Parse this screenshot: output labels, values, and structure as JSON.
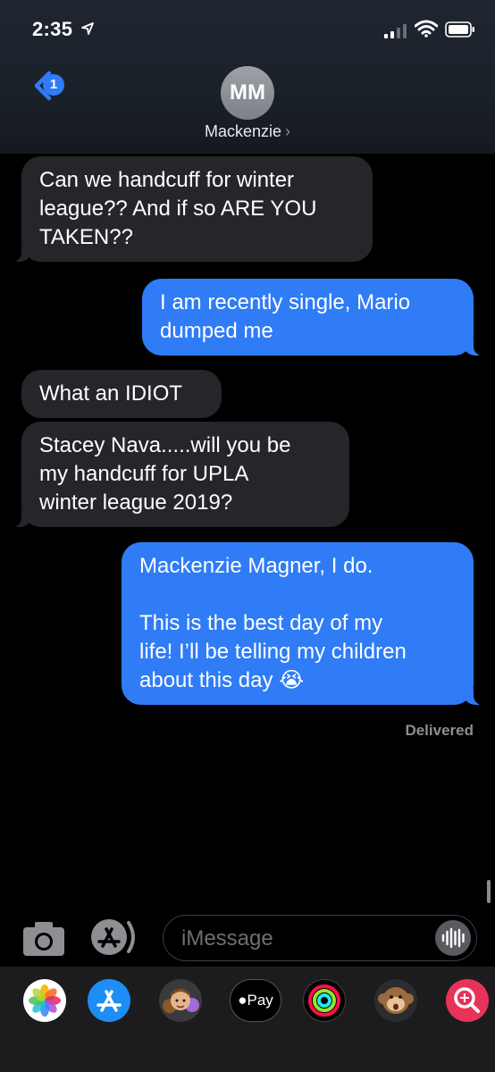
{
  "status_bar": {
    "time": "2:35"
  },
  "header": {
    "back_count": "1",
    "avatar_initials": "MM",
    "contact_name": "Mackenzie",
    "chevron": "›"
  },
  "messages": [
    {
      "direction": "incoming",
      "text": "Can we handcuff for winter\nleague?? And if so ARE YOU\nTAKEN??"
    },
    {
      "direction": "outgoing",
      "text": "I am recently single, Mario\ndumped me"
    },
    {
      "direction": "incoming",
      "text": "What an IDIOT"
    },
    {
      "direction": "incoming",
      "text": "Stacey Nava.....will you be\nmy handcuff for UPLA\nwinter league 2019?"
    },
    {
      "direction": "outgoing",
      "text": "Mackenzie Magner, I do.\n\nThis is the best day of my\nlife! I’ll be telling my children\nabout this day 😭"
    }
  ],
  "delivery_status": "Delivered",
  "composer": {
    "placeholder": "iMessage",
    "camera_icon": "camera-icon",
    "apps_icon": "app-store-icon",
    "audio_icon": "audio-waveform-icon"
  },
  "app_drawer": {
    "items": [
      {
        "name": "photos-icon"
      },
      {
        "name": "app-store-icon"
      },
      {
        "name": "memoji-icon"
      },
      {
        "name": "apple-pay-icon",
        "label": "Pay"
      },
      {
        "name": "activity-icon"
      },
      {
        "name": "animoji-monkey-icon"
      },
      {
        "name": "image-search-icon"
      }
    ]
  },
  "colors": {
    "outgoing_bubble": "#2f7cf6",
    "incoming_bubble": "#26252a",
    "background": "#000000"
  }
}
